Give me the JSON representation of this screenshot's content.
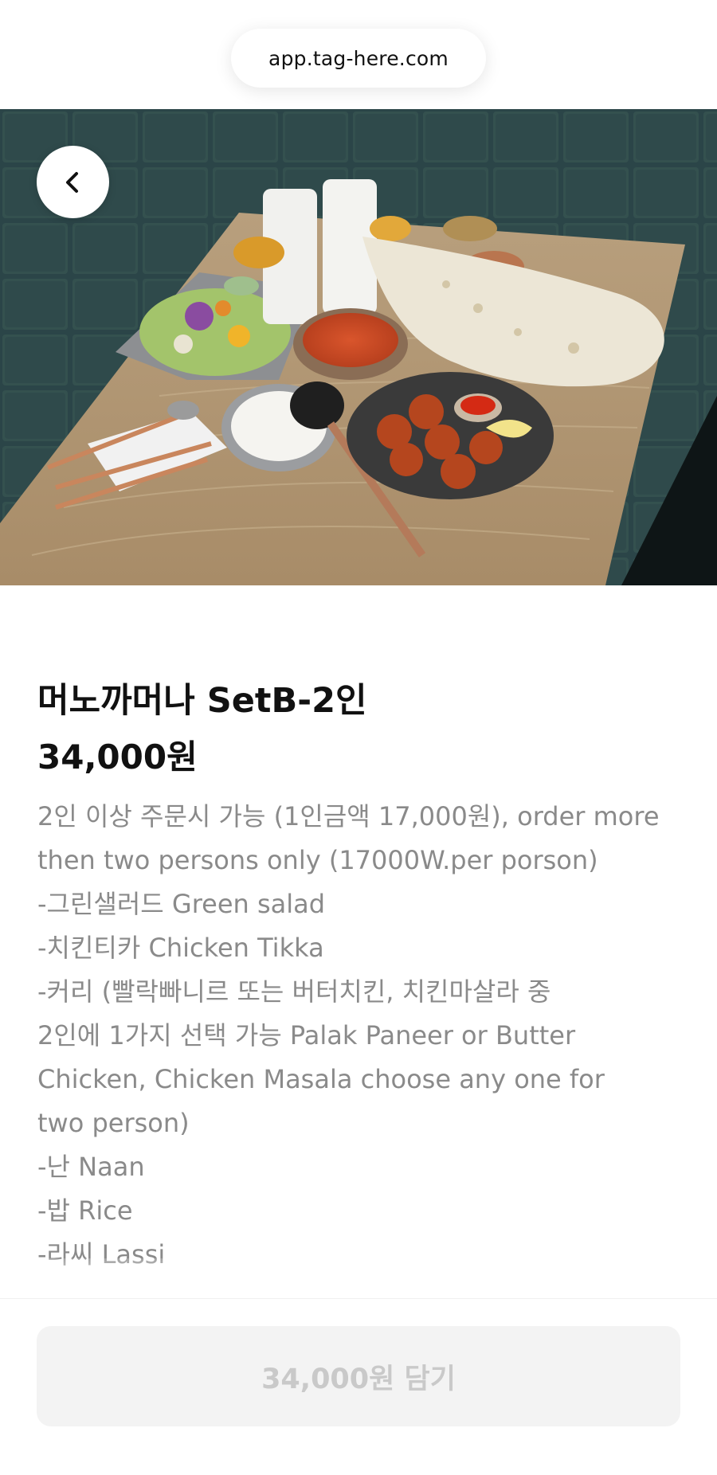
{
  "browser": {
    "url": "app.tag-here.com"
  },
  "hero": {
    "alt": "food photo",
    "back_icon": "chevron-left-icon"
  },
  "product": {
    "title": "머노까머나 SetB-2인",
    "price": "34,000원",
    "description_lines": [
      "2인 이상 주문시 가능 (1인금액 17,000원), order more",
      "then two persons only (17000W.per porson)",
      "-그린샐러드 Green salad",
      "-치킨티카 Chicken Tikka",
      "-커리 (빨락빠니르 또는 버터치킨, 치킨마살라 중",
      "2인에 1가지 선택 가능 Palak Paneer or Butter",
      "Chicken, Chicken Masala choose any one for",
      "two person)",
      "-난 Naan",
      "-밥 Rice",
      "-라씨 Lassi"
    ]
  },
  "footer": {
    "add_button_label": "34,000원 담기"
  },
  "colors": {
    "title": "#111111",
    "description": "#8a8a8a",
    "button_bg": "#f3f3f3",
    "button_text": "#c9c9c9"
  }
}
